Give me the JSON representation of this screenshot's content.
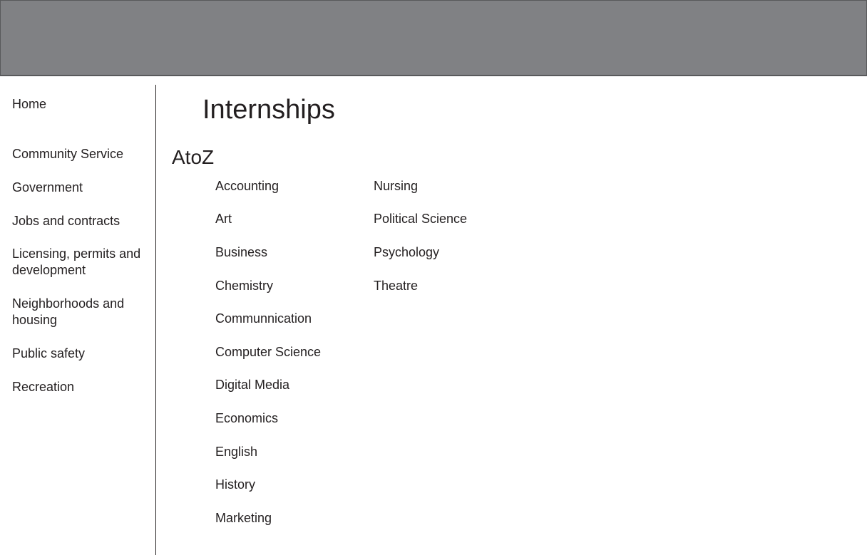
{
  "sidebar": {
    "items": [
      {
        "label": "Home"
      },
      {
        "label": "Community Service"
      },
      {
        "label": "Government"
      },
      {
        "label": "Jobs and contracts"
      },
      {
        "label": "Licensing, permits and\ndevelopment"
      },
      {
        "label": "Neighborhoods and\nhousing"
      },
      {
        "label": "Public safety"
      },
      {
        "label": "Recreation"
      }
    ]
  },
  "main": {
    "title": "Internships",
    "section_heading": "AtoZ",
    "subjects_col1": [
      "Accounting",
      "Art",
      "Business",
      "Chemistry",
      "Communnication",
      "Computer Science",
      "Digital Media",
      "Economics",
      "English",
      "History",
      "Marketing"
    ],
    "subjects_col2": [
      "Nursing",
      "Political Science",
      "Psychology",
      "Theatre"
    ]
  },
  "colors": {
    "header_bar": "#808184",
    "text": "#231f20"
  }
}
